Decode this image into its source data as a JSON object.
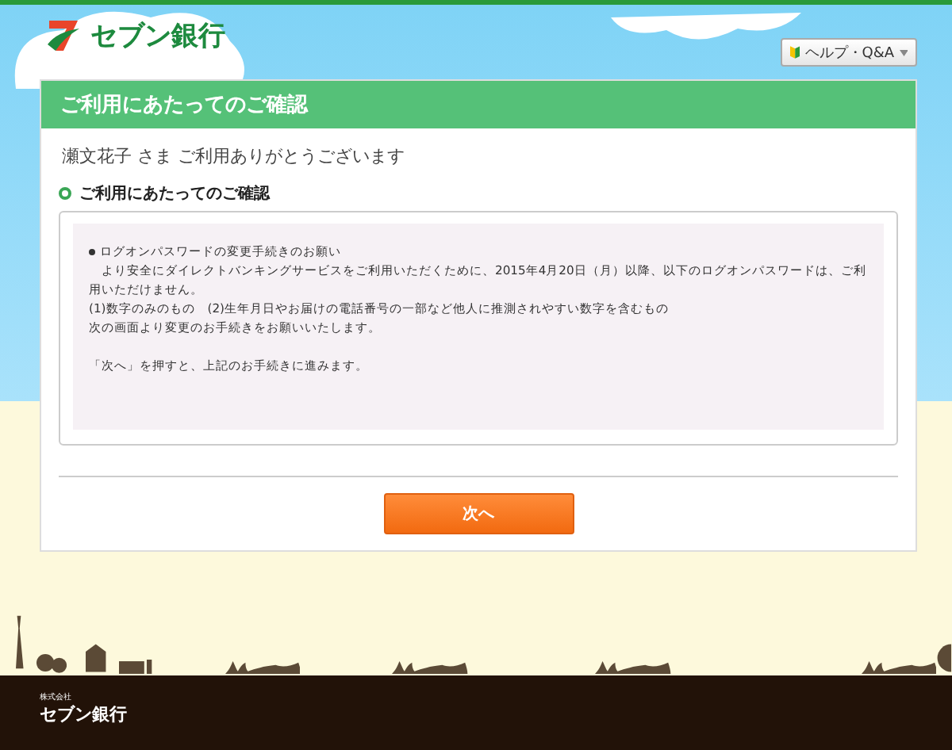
{
  "header": {
    "logo_text": "セブン銀行",
    "help_menu": "ヘルプ・Q&A"
  },
  "card": {
    "title": "ご利用にあたってのご確認",
    "greeting": "瀬文花子 さま ご利用ありがとうございます",
    "section_title": "ご利用にあたってのご確認",
    "notice": {
      "heading": "ログオンパスワードの変更手続きのお願い",
      "lines": [
        "　より安全にダイレクトバンキングサービスをご利用いただくために、2015年4月20日（月）以降、以下のログオンパスワードは、ご利用いただけません。",
        "(1)数字のみのもの　(2)生年月日やお届けの電話番号の一部など他人に推測されやすい数字を含むもの",
        "次の画面より変更のお手続きをお願いいたします。"
      ],
      "footnote": "「次へ」を押すと、上記のお手続きに進みます。"
    },
    "next_button": "次へ"
  },
  "footer": {
    "company_prefix": "株式会社",
    "company_name": "セブン銀行"
  }
}
